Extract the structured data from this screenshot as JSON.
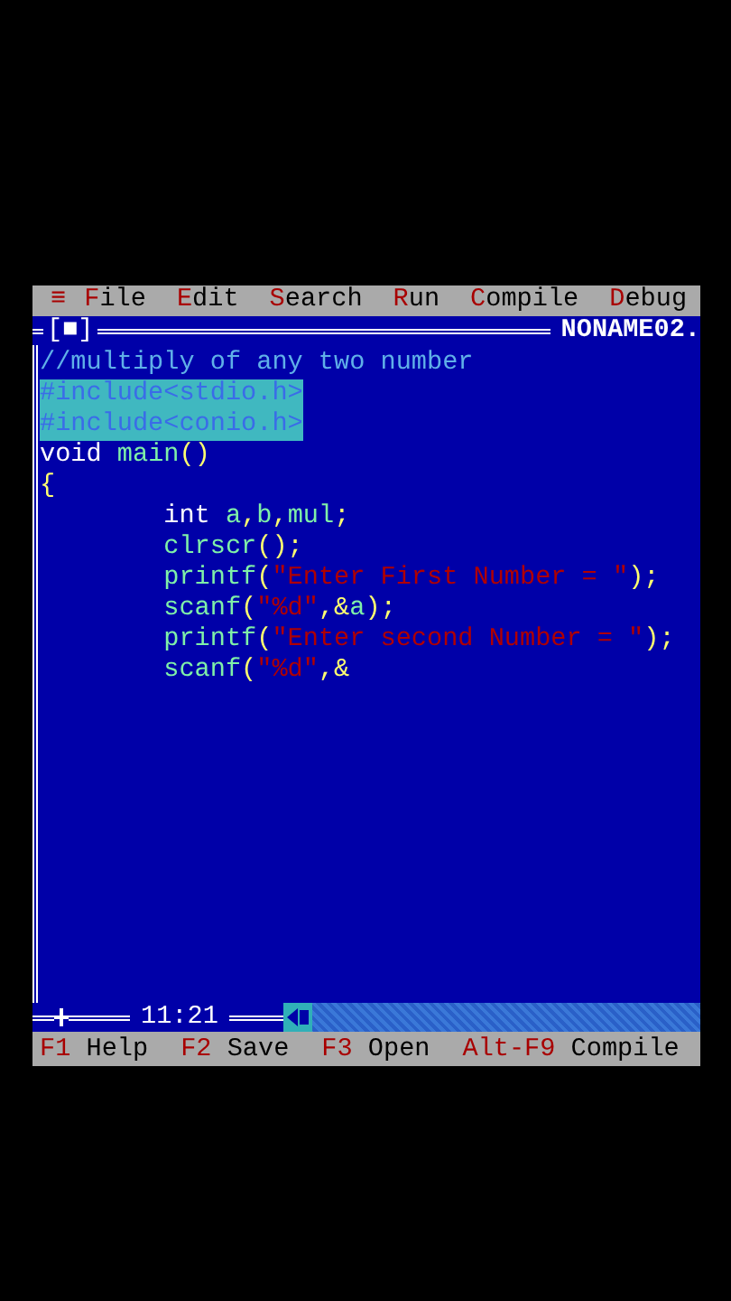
{
  "menu_bar": {
    "system_icon": "≡",
    "items": [
      "**F**ile",
      "**E**dit",
      "**S**earch",
      "**R**un",
      "**C**ompile",
      "**D**ebug"
    ]
  },
  "window": {
    "close_box": "[■]",
    "title": "NONAME02."
  },
  "editor": {
    "lines": [
      [
        {
          "kind": "comment",
          "text": "//multiply of any two number"
        }
      ],
      [
        {
          "kind": "directive",
          "text": "#include<stdio.h>"
        }
      ],
      [
        {
          "kind": "directive",
          "text": "#include<conio.h>"
        }
      ],
      [
        {
          "kind": "plain",
          "text": "void "
        },
        {
          "kind": "ident",
          "text": "main"
        },
        {
          "kind": "symbol",
          "text": "()"
        }
      ],
      [
        {
          "kind": "symbol",
          "text": "{"
        }
      ],
      [
        {
          "kind": "plain",
          "text": "        int "
        },
        {
          "kind": "ident",
          "text": "a"
        },
        {
          "kind": "symbol",
          "text": ","
        },
        {
          "kind": "ident",
          "text": "b"
        },
        {
          "kind": "symbol",
          "text": ","
        },
        {
          "kind": "ident",
          "text": "mul"
        },
        {
          "kind": "symbol",
          "text": ";"
        }
      ],
      [
        {
          "kind": "ident",
          "text": "        clrscr"
        },
        {
          "kind": "symbol",
          "text": "();"
        }
      ],
      [
        {
          "kind": "ident",
          "text": "        printf"
        },
        {
          "kind": "symbol",
          "text": "("
        },
        {
          "kind": "string",
          "text": "\"Enter First Number = \""
        },
        {
          "kind": "symbol",
          "text": ");"
        }
      ],
      [
        {
          "kind": "ident",
          "text": "        scanf"
        },
        {
          "kind": "symbol",
          "text": "("
        },
        {
          "kind": "string",
          "text": "\"%d\""
        },
        {
          "kind": "symbol",
          "text": ",&"
        },
        {
          "kind": "ident",
          "text": "a"
        },
        {
          "kind": "symbol",
          "text": ");"
        }
      ],
      [
        {
          "kind": "ident",
          "text": "        printf"
        },
        {
          "kind": "symbol",
          "text": "("
        },
        {
          "kind": "string",
          "text": "\"Enter second Number = \""
        },
        {
          "kind": "symbol",
          "text": ");"
        }
      ],
      [
        {
          "kind": "ident",
          "text": "        scanf"
        },
        {
          "kind": "symbol",
          "text": "("
        },
        {
          "kind": "string",
          "text": "\"%d\""
        },
        {
          "kind": "symbol",
          "text": ",&"
        }
      ]
    ],
    "cursor_position": "11:21"
  },
  "status_bar": [
    {
      "key": "F1",
      "label": "Help"
    },
    {
      "key": "F2",
      "label": "Save"
    },
    {
      "key": "F3",
      "label": "Open"
    },
    {
      "key": "Alt-F9",
      "label": "Compile"
    }
  ]
}
